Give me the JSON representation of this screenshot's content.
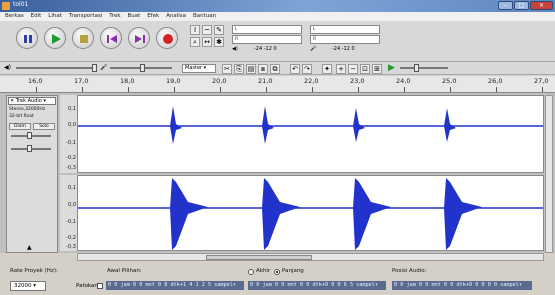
{
  "window": {
    "title": "tol01",
    "min": "–",
    "max": "□",
    "close": "✕"
  },
  "menu": [
    "Berkas",
    "Edit",
    "Lihat",
    "Transportasi",
    "Trek",
    "Buat",
    "Efek",
    "Analisa",
    "Bantuan"
  ],
  "meters": {
    "l": "L",
    "r": "R",
    "play_vals": "-24  -12  0",
    "rec_vals": "-24  -12  0"
  },
  "device": {
    "selected": "Master"
  },
  "ruler": {
    "ticks": [
      "16,0",
      "17,0",
      "18,0",
      "19,0",
      "20,0",
      "21,0",
      "22,0",
      "23,0",
      "24,0",
      "25,0",
      "26,0",
      "27,0"
    ]
  },
  "track": {
    "name": "Trek Audio",
    "info1": "Stereo,32000Hz",
    "info2": "32-bit float",
    "mute": "Diam",
    "solo": "Solo",
    "scale_top": [
      "0,1",
      "0,0",
      "-0,1",
      "-0,2",
      "-0,3"
    ],
    "scale_bottom": [
      "0,1",
      "0,0",
      "-0,1",
      "-0,2",
      "-0,3"
    ]
  },
  "bottom": {
    "rate_label": "Rate Proyek (Hz):",
    "rate_value": "32000",
    "start_label": "Awal Pilihan:",
    "snap_label": "Patokan",
    "start_time": "0 0  jam 0 0  mnt 0 8  dtk+1 4 1 2 5  sampel▾",
    "end_opt": "Akhir",
    "len_opt": "Panjang",
    "end_time": "0 0  jam 0 0  mnt 0 0  dtk+0 0 0 6 5  sampel▾",
    "pos_label": "Posisi Audio:",
    "pos_time": "0 0  jam 0 0  mnt 0 0  dtk+0 0 0 0 0  sampel▾"
  },
  "colors": {
    "waveform": "#2233cc",
    "timebox": "#5a6b8f"
  }
}
